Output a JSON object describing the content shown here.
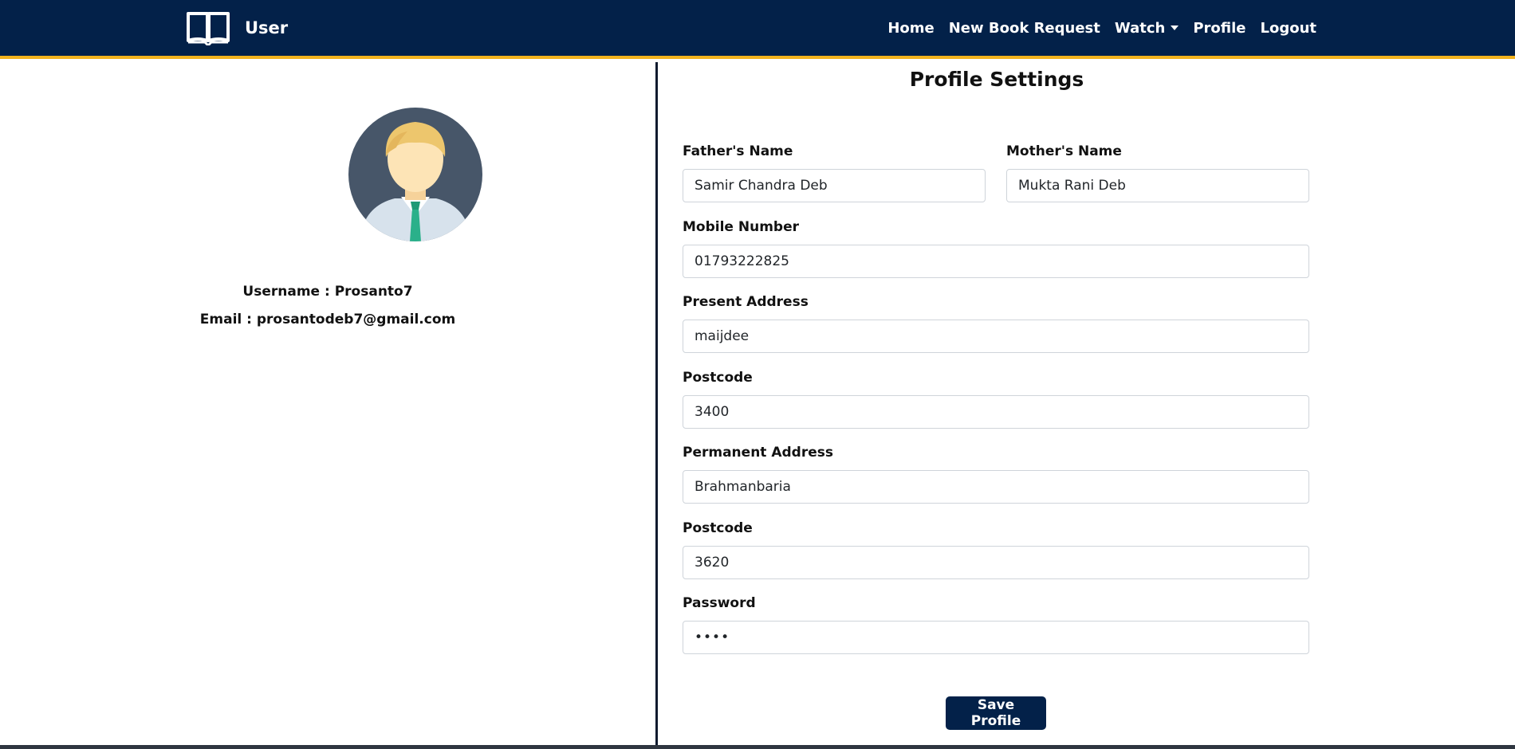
{
  "navbar": {
    "brand_text": "User",
    "links": [
      "Home",
      "New Book Request",
      "Watch",
      "Profile",
      "Logout"
    ],
    "brand_color": "#032149",
    "accent_color": "#f3b31d"
  },
  "profile": {
    "username_line": "Username : Prosanto7",
    "email_line": "Email : prosantodeb7@gmail.com"
  },
  "form": {
    "title": "Profile Settings",
    "fathers_name_label": "Father's Name",
    "fathers_name_value": "Samir Chandra Deb",
    "mothers_name_label": "Mother's Name",
    "mothers_name_value": "Mukta Rani Deb",
    "mobile_label": "Mobile Number",
    "mobile_value": "01793222825",
    "present_address_label": "Present Address",
    "present_address_value": "maijdee",
    "present_postcode_label": "Postcode",
    "present_postcode_value": "3400",
    "permanent_address_label": "Permanent Address",
    "permanent_address_value": "Brahmanbaria",
    "permanent_postcode_label": "Postcode",
    "permanent_postcode_value": "3620",
    "password_label": "Password",
    "password_value": "••••",
    "save_label": "Save Profile"
  }
}
